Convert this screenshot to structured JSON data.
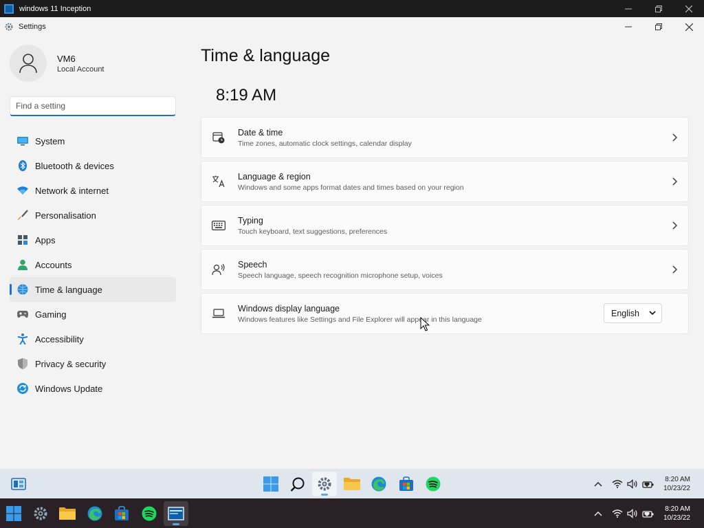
{
  "vm_window": {
    "title": "windows 11 Inception"
  },
  "settings_window": {
    "title": "Settings"
  },
  "profile": {
    "name": "VM6",
    "account_type": "Local Account"
  },
  "search": {
    "placeholder": "Find a setting"
  },
  "nav": {
    "items": [
      {
        "label": "System",
        "icon": "monitor-icon"
      },
      {
        "label": "Bluetooth & devices",
        "icon": "bluetooth-icon"
      },
      {
        "label": "Network & internet",
        "icon": "wifi-icon"
      },
      {
        "label": "Personalisation",
        "icon": "brush-icon"
      },
      {
        "label": "Apps",
        "icon": "apps-icon"
      },
      {
        "label": "Accounts",
        "icon": "person-icon"
      },
      {
        "label": "Time & language",
        "icon": "globe-clock-icon",
        "selected": true
      },
      {
        "label": "Gaming",
        "icon": "gamepad-icon"
      },
      {
        "label": "Accessibility",
        "icon": "accessibility-icon"
      },
      {
        "label": "Privacy & security",
        "icon": "shield-icon"
      },
      {
        "label": "Windows Update",
        "icon": "update-icon"
      }
    ]
  },
  "main": {
    "title": "Time & language",
    "clock": "8:19 AM",
    "cards": [
      {
        "title": "Date & time",
        "subtitle": "Time zones, automatic clock settings, calendar display",
        "icon": "calendar-clock-icon"
      },
      {
        "title": "Language & region",
        "subtitle": "Windows and some apps format dates and times based on your region",
        "icon": "language-icon"
      },
      {
        "title": "Typing",
        "subtitle": "Touch keyboard, text suggestions, preferences",
        "icon": "keyboard-icon"
      },
      {
        "title": "Speech",
        "subtitle": "Speech language, speech recognition microphone setup, voices",
        "icon": "speech-icon"
      },
      {
        "title": "Windows display language",
        "subtitle": "Windows features like Settings and File Explorer will appear in this language",
        "icon": "laptop-icon",
        "select_value": "English"
      }
    ]
  },
  "taskbar_inner": {
    "time": "8:20 AM",
    "date": "10/23/22"
  },
  "taskbar_outer": {
    "time": "8:20 AM",
    "date": "10/23/22"
  },
  "colors": {
    "accent": "#1a73c8",
    "window_bg": "#f3f3f3",
    "card_bg": "#fbfbfb",
    "taskbar_inner_bg": "#dfe6ee",
    "taskbar_outer_bg": "#2a2127"
  }
}
